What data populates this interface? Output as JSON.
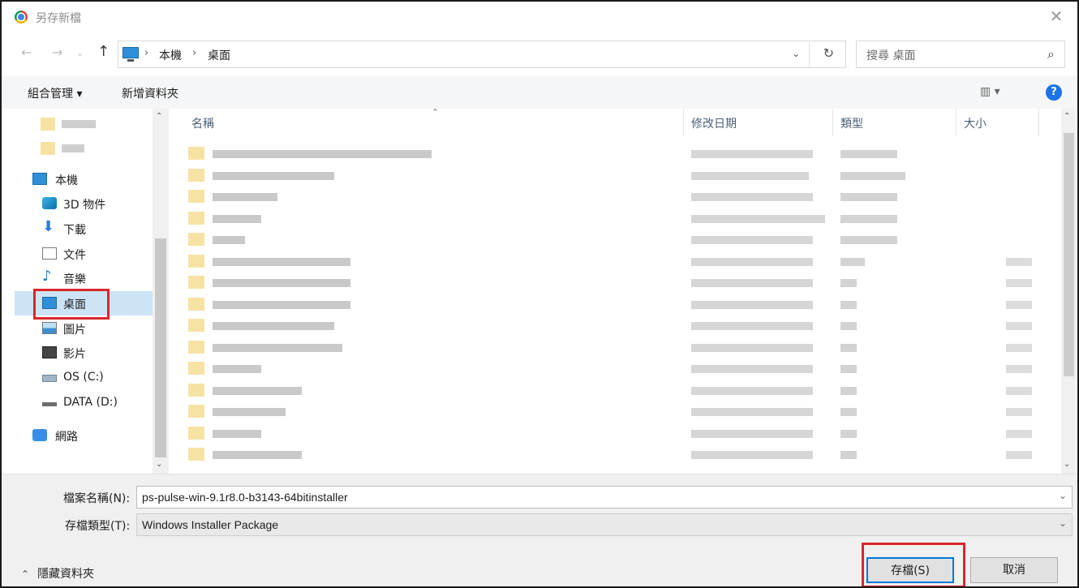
{
  "window": {
    "title": "另存新檔",
    "close_glyph": "✕"
  },
  "address": {
    "back_glyph": "←",
    "forward_glyph": "→",
    "recent_glyph": "⌄",
    "up_glyph": "↑",
    "crumbs": [
      "本機",
      "桌面"
    ],
    "separator": "›",
    "dropdown_glyph": "⌄",
    "refresh_glyph": "↻"
  },
  "search": {
    "placeholder": "搜尋 桌面",
    "icon_glyph": "⌕"
  },
  "toolbar": {
    "organize_label": "組合管理 ▾",
    "new_folder_label": "新增資料夾",
    "view_glyph": "▥ ▾",
    "help_glyph": "?"
  },
  "nav_pane": {
    "items": [
      {
        "label": "本機",
        "icon": "pc-icon"
      },
      {
        "label": "3D 物件",
        "icon": "3d-objects-icon"
      },
      {
        "label": "下載",
        "icon": "download-icon"
      },
      {
        "label": "文件",
        "icon": "document-icon"
      },
      {
        "label": "音樂",
        "icon": "music-icon"
      },
      {
        "label": "桌面",
        "icon": "desktop-icon"
      },
      {
        "label": "圖片",
        "icon": "pictures-icon"
      },
      {
        "label": "影片",
        "icon": "videos-icon"
      },
      {
        "label": "OS (C:)",
        "icon": "drive-icon"
      },
      {
        "label": "DATA (D:)",
        "icon": "drive-icon"
      },
      {
        "label": "網路",
        "icon": "network-icon"
      }
    ],
    "selected": "桌面",
    "scroll_up_glyph": "⌃",
    "scroll_down_glyph": "⌄",
    "down_arrow_glyph": "⬇",
    "music_glyph": "♪"
  },
  "file_list": {
    "columns": [
      "名稱",
      "修改日期",
      "類型",
      "大小"
    ],
    "sort_glyph": "⌃",
    "scroll_up_glyph": "⌃",
    "scroll_down_glyph": "⌄"
  },
  "footer": {
    "filename_label": "檔案名稱(N):",
    "filename_value": "ps-pulse-win-9.1r8.0-b3143-64bitinstaller",
    "filetype_label": "存檔類型(T):",
    "filetype_value": "Windows Installer Package",
    "dropdown_glyph": "⌄",
    "hide_folders_label": "隱藏資料夾",
    "hide_folders_glyph": "⌃",
    "save_label": "存檔(S)",
    "cancel_label": "取消"
  },
  "colors": {
    "highlight_box": "#d9262c",
    "selection": "#cde4f7",
    "help": "#1a73e8"
  }
}
